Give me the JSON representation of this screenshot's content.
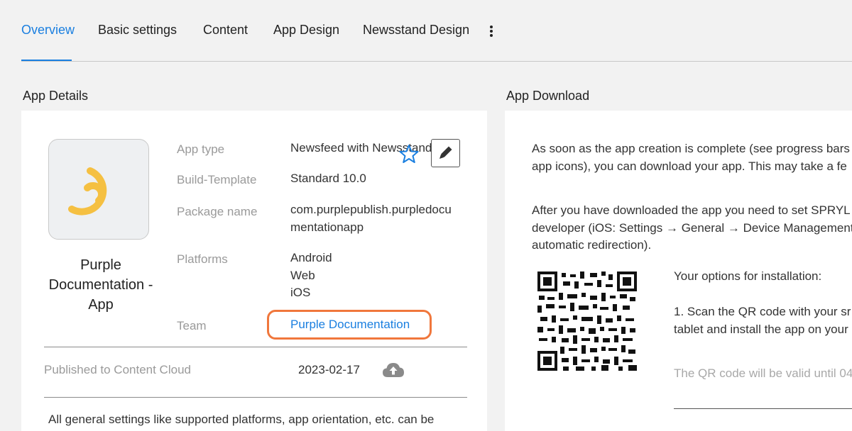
{
  "tabs": [
    {
      "label": "Overview",
      "active": true
    },
    {
      "label": "Basic settings"
    },
    {
      "label": "Content"
    },
    {
      "label": "App Design"
    },
    {
      "label": "Newsstand Design"
    }
  ],
  "more_icon": "vertical-dots-icon",
  "accent_color": "#1a7fe0",
  "highlight_color": "#f0773c",
  "app_details": {
    "title": "App Details",
    "app_name": "Purple Documentation - App",
    "fields": {
      "app_type": {
        "label": "App type",
        "value": "Newsfeed with Newsstand"
      },
      "build_template": {
        "label": "Build-Template",
        "value": "Standard 10.0"
      },
      "package_name": {
        "label": "Package name",
        "value_line1": "com.purplepublish.purpledocu",
        "value_line2": "mentationapp"
      },
      "platforms": {
        "label": "Platforms",
        "values": [
          "Android",
          "Web",
          "iOS"
        ]
      },
      "team": {
        "label": "Team",
        "value": "Purple Documentation"
      }
    },
    "published": {
      "label": "Published to Content Cloud",
      "date": "2023-02-17"
    },
    "note": "All general settings like supported platforms, app orientation, etc. can be",
    "icons": {
      "edit": "pencil-icon",
      "favorite": "star-icon",
      "upload": "cloud-upload-icon",
      "app": "app-logo-icon"
    }
  },
  "app_download": {
    "title": "App Download",
    "para1": [
      "As soon as the app creation is complete (see progress bars",
      "app icons), you can download your app. This may take a fe"
    ],
    "para2": [
      "After you have downloaded the app you need to set SPRYL",
      "developer (iOS: Settings → General → Device Management",
      "automatic redirection)."
    ],
    "options_title": "Your options for installation:",
    "option1": [
      "1. Scan the QR code with your sr",
      "tablet and install the app on your"
    ],
    "qr_validity": "The QR code will be valid until 04"
  }
}
